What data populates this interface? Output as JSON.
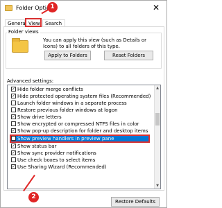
{
  "window": {
    "title": "Folder Options",
    "close_glyph": "✕"
  },
  "tabs": [
    {
      "label": "General"
    },
    {
      "label": "View"
    },
    {
      "label": "Search"
    }
  ],
  "folder_views": {
    "group_label": "Folder views",
    "description": "You can apply this view (such as Details or Icons) to all folders of this type.",
    "apply_button": "Apply to Folders",
    "reset_button": "Reset Folders"
  },
  "advanced": {
    "label": "Advanced settings:",
    "items": [
      {
        "label": "Hide folder merge conflicts",
        "checked": true
      },
      {
        "label": "Hide protected operating system files (Recommended)",
        "checked": true
      },
      {
        "label": "Launch folder windows in a separate process",
        "checked": false
      },
      {
        "label": "Restore previous folder windows at logon",
        "checked": false
      },
      {
        "label": "Show drive letters",
        "checked": true
      },
      {
        "label": "Show encrypted or compressed NTFS files in color",
        "checked": false
      },
      {
        "label": "Show pop-up description for folder and desktop items",
        "checked": true
      },
      {
        "label": "Show preview handlers in preview pane",
        "checked": false
      },
      {
        "label": "Show status bar",
        "checked": true
      },
      {
        "label": "Show sync provider notifications",
        "checked": true
      },
      {
        "label": "Use check boxes to select items",
        "checked": false
      },
      {
        "label": "Use Sharing Wizard (Recommended)",
        "checked": true
      }
    ],
    "restore_button": "Restore Defaults"
  },
  "annotations": {
    "step1": "1",
    "step2": "2",
    "color": "#e02424"
  },
  "scrollbar": {
    "up_glyph": "▲",
    "down_glyph": "▼"
  }
}
